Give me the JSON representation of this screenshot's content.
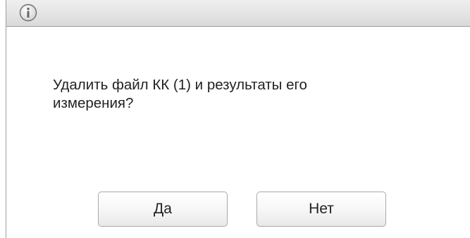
{
  "dialog": {
    "icon": "info-icon",
    "message_line1": "Удалить файл КК (1) и результаты его",
    "message_line2": "измерения?",
    "yes_label": "Да",
    "no_label": "Нет"
  },
  "colors": {
    "titlebar": "#e3e3e3",
    "border": "#9e9e9e",
    "text": "#222222"
  }
}
